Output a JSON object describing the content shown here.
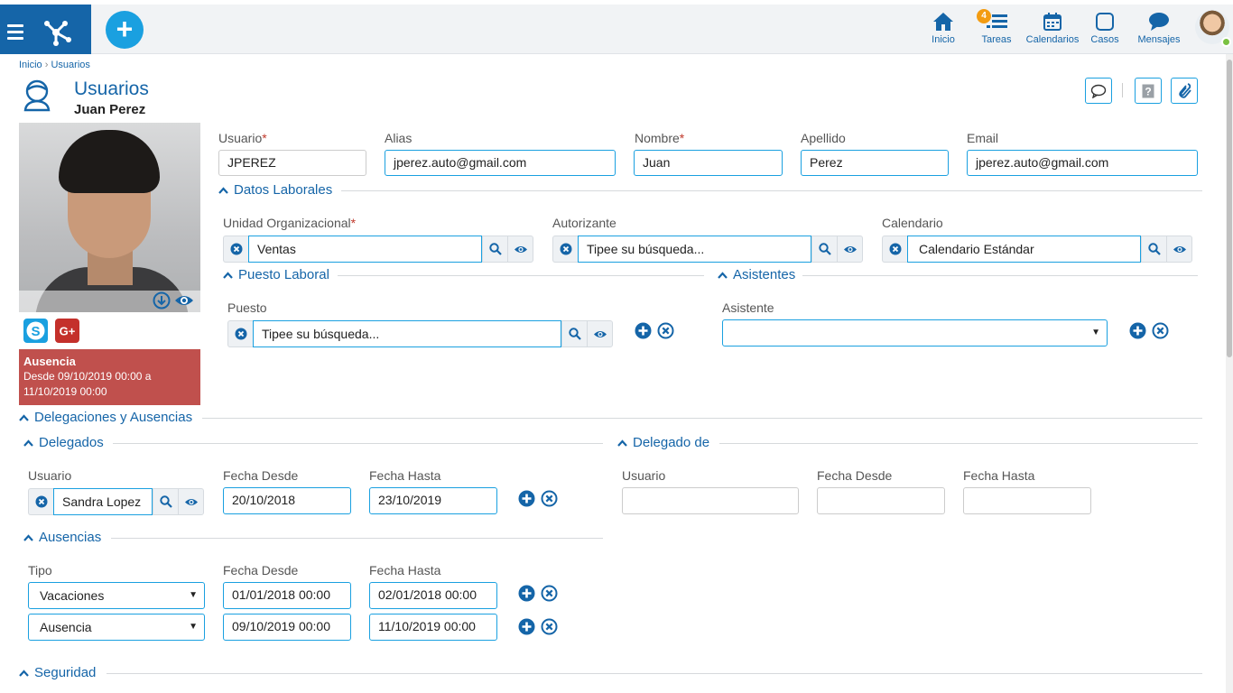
{
  "nav": {
    "items": [
      {
        "label": "Inicio",
        "icon": "home-icon"
      },
      {
        "label": "Tareas",
        "icon": "tasks-icon",
        "badge": "4"
      },
      {
        "label": "Calendarios",
        "icon": "calendar-icon"
      },
      {
        "label": "Casos",
        "icon": "cases-icon"
      },
      {
        "label": "Mensajes",
        "icon": "messages-icon"
      }
    ],
    "add_label": "+"
  },
  "breadcrumb": {
    "home": "Inicio",
    "sep": "›",
    "current": "Usuarios"
  },
  "header": {
    "title": "Usuarios",
    "subtitle": "Juan Perez"
  },
  "absence": {
    "title": "Ausencia",
    "line1": "Desde 09/10/2019 00:00 a",
    "line2": "11/10/2019 00:00"
  },
  "user_fields": {
    "usuario": {
      "label": "Usuario",
      "required": "*",
      "value": "JPEREZ"
    },
    "alias": {
      "label": "Alias",
      "value": "jperez.auto@gmail.com"
    },
    "nombre": {
      "label": "Nombre",
      "required": "*",
      "value": "Juan"
    },
    "apellido": {
      "label": "Apellido",
      "value": "Perez"
    },
    "email": {
      "label": "Email",
      "value": "jperez.auto@gmail.com"
    }
  },
  "datos_laborales": {
    "title": "Datos Laborales",
    "unidad": {
      "label": "Unidad Organizacional",
      "required": "*",
      "value": "Ventas"
    },
    "autorizante": {
      "label": "Autorizante",
      "placeholder": "Tipee su búsqueda..."
    },
    "calendario": {
      "label": "Calendario",
      "value": "Calendario Estándar"
    }
  },
  "puesto_laboral": {
    "title": "Puesto Laboral",
    "label": "Puesto",
    "placeholder": "Tipee su búsqueda..."
  },
  "asistentes": {
    "title": "Asistentes",
    "label": "Asistente",
    "value": ""
  },
  "delegaciones": {
    "title": "Delegaciones y Ausencias",
    "delegados": {
      "title": "Delegados",
      "col_usuario": "Usuario",
      "col_desde": "Fecha Desde",
      "col_hasta": "Fecha Hasta",
      "usuario": "Sandra Lopez",
      "desde": "20/10/2018",
      "hasta": "23/10/2019"
    },
    "delegado_de": {
      "title": "Delegado de",
      "col_usuario": "Usuario",
      "col_desde": "Fecha Desde",
      "col_hasta": "Fecha Hasta"
    },
    "ausencias": {
      "title": "Ausencias",
      "col_tipo": "Tipo",
      "col_desde": "Fecha Desde",
      "col_hasta": "Fecha Hasta",
      "rows": [
        {
          "tipo": "Vacaciones",
          "desde": "01/01/2018 00:00",
          "hasta": "02/01/2018 00:00"
        },
        {
          "tipo": "Ausencia",
          "desde": "09/10/2019 00:00",
          "hasta": "11/10/2019 00:00"
        }
      ]
    }
  },
  "seguridad": {
    "title": "Seguridad"
  },
  "colors": {
    "primary": "#1565a8",
    "accent": "#1aa0e0",
    "absence": "#c0504d",
    "badge": "#f39c12"
  }
}
